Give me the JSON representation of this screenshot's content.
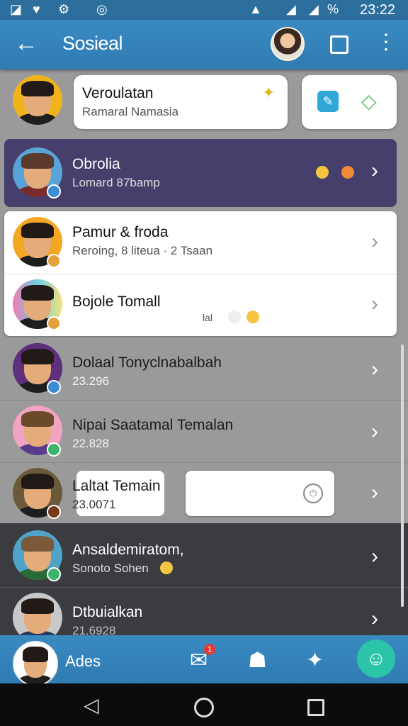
{
  "status_bar": {
    "time": "23:22",
    "battery": "%"
  },
  "app_bar": {
    "title": "Sosieal"
  },
  "top_card": {
    "name": "Veroulatan",
    "subtitle": "Ramaral Namasia"
  },
  "chats": [
    {
      "name": "Obrolia",
      "subtitle": "Lomard 87bamp"
    },
    {
      "name": "Pamur & froda",
      "subtitle": "Reroing, 8 liteua · 2 Tsaan"
    },
    {
      "name": "Bojole Tomall",
      "subtitle": "",
      "tag": "lal"
    },
    {
      "name": "Dolaal Tonyclnabalbah",
      "subtitle": "23.296"
    },
    {
      "name": "Nipai Saatamal Temalan",
      "subtitle": "22.828"
    },
    {
      "name": "Laltat Temain",
      "subtitle": "23.0071"
    },
    {
      "name": "Ansaldemiratom,",
      "subtitle": "Sonoto Sohen"
    },
    {
      "name": "Dtbuialkan",
      "subtitle": "21.6928"
    }
  ],
  "bottom_bar": {
    "label": "Ades",
    "badge": "1"
  },
  "colors": {
    "primary": "#2f7bb2",
    "accent": "#2bc4a8",
    "highlight": "#463f6b"
  },
  "icons": [
    "wifi-icon",
    "battery-icon",
    "signal-icon",
    "back-arrow-icon",
    "square-icon",
    "more-vert-icon",
    "chevron-right-icon",
    "home-icon",
    "recent-apps-icon"
  ]
}
